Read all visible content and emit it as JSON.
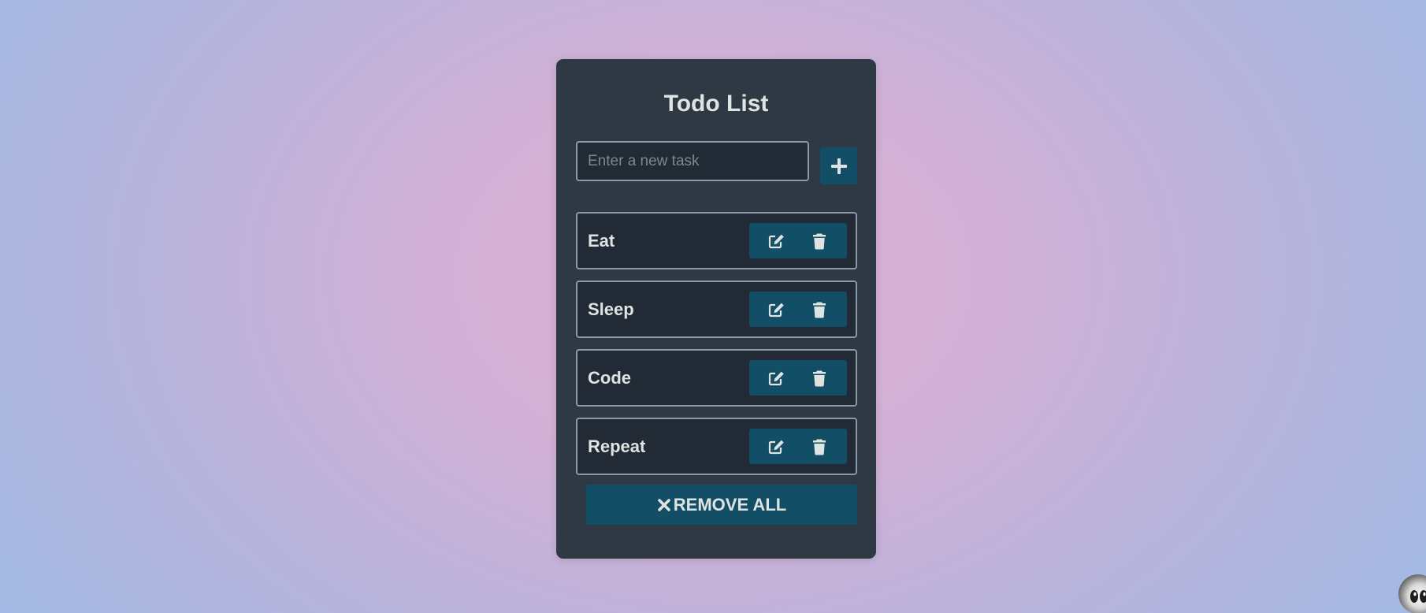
{
  "app": {
    "title": "Todo List"
  },
  "input": {
    "placeholder": "Enter a new task",
    "value": ""
  },
  "buttons": {
    "add_icon": "plus-icon",
    "edit_icon": "edit-icon",
    "delete_icon": "trash-icon",
    "remove_all_label": "REMOVE ALL",
    "remove_all_icon": "close-icon"
  },
  "todos": [
    {
      "text": "Eat"
    },
    {
      "text": "Sleep"
    },
    {
      "text": "Code"
    },
    {
      "text": "Repeat"
    }
  ],
  "colors": {
    "card_background": "#2e3944",
    "item_background": "#212a35",
    "accent": "#124e66",
    "text": "#dfe3e1",
    "border": "#8a9aa3"
  }
}
